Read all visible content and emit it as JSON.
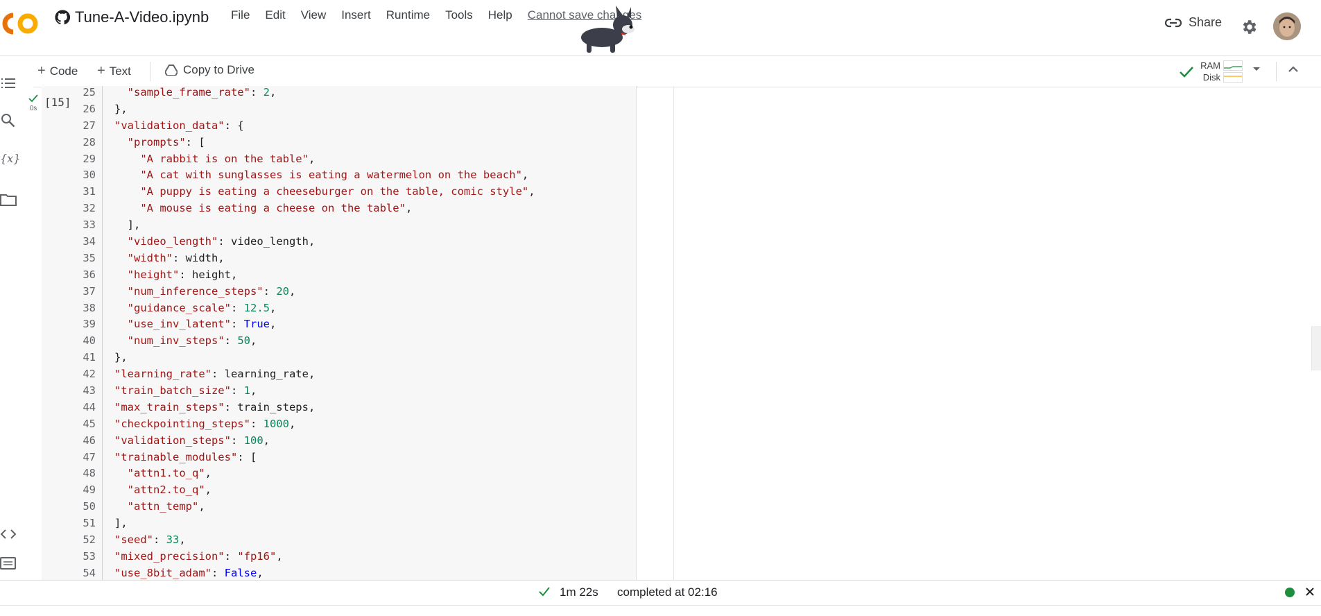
{
  "header": {
    "notebook_title": "Tune-A-Video.ipynb",
    "menu": [
      "File",
      "Edit",
      "View",
      "Insert",
      "Runtime",
      "Tools",
      "Help"
    ],
    "cannot_save": "Cannot save changes",
    "share_label": "Share"
  },
  "toolbar": {
    "code_label": "Code",
    "text_label": "Text",
    "copy_label": "Copy to Drive",
    "ram_label": "RAM",
    "disk_label": "Disk"
  },
  "cell": {
    "status_time": "0s",
    "exec_count": "[15]"
  },
  "code_lines": [
    {
      "n": "25",
      "html": "  <span class='s'>\"sample_frame_rate\"</span>: <span class='n'>2</span>,"
    },
    {
      "n": "26",
      "html": "},"
    },
    {
      "n": "27",
      "html": "<span class='s'>\"validation_data\"</span>: {"
    },
    {
      "n": "28",
      "html": "  <span class='s'>\"prompts\"</span>: ["
    },
    {
      "n": "29",
      "html": "    <span class='s'>\"A rabbit is on the table\"</span>,"
    },
    {
      "n": "30",
      "html": "    <span class='s'>\"A cat with sunglasses is eating a watermelon on the beach\"</span>,"
    },
    {
      "n": "31",
      "html": "    <span class='s'>\"A puppy is eating a cheeseburger on the table, comic style\"</span>,"
    },
    {
      "n": "32",
      "html": "    <span class='s'>\"A mouse is eating a cheese on the table\"</span>,"
    },
    {
      "n": "33",
      "html": "  ],"
    },
    {
      "n": "34",
      "html": "  <span class='s'>\"video_length\"</span>: video_length,"
    },
    {
      "n": "35",
      "html": "  <span class='s'>\"width\"</span>: width,"
    },
    {
      "n": "36",
      "html": "  <span class='s'>\"height\"</span>: height,"
    },
    {
      "n": "37",
      "html": "  <span class='s'>\"num_inference_steps\"</span>: <span class='n'>20</span>,"
    },
    {
      "n": "38",
      "html": "  <span class='s'>\"guidance_scale\"</span>: <span class='n'>12.5</span>,"
    },
    {
      "n": "39",
      "html": "  <span class='s'>\"use_inv_latent\"</span>: <span class='k'>True</span>,"
    },
    {
      "n": "40",
      "html": "  <span class='s'>\"num_inv_steps\"</span>: <span class='n'>50</span>,"
    },
    {
      "n": "41",
      "html": "},"
    },
    {
      "n": "42",
      "html": "<span class='s'>\"learning_rate\"</span>: learning_rate,"
    },
    {
      "n": "43",
      "html": "<span class='s'>\"train_batch_size\"</span>: <span class='n'>1</span>,"
    },
    {
      "n": "44",
      "html": "<span class='s'>\"max_train_steps\"</span>: train_steps,"
    },
    {
      "n": "45",
      "html": "<span class='s'>\"checkpointing_steps\"</span>: <span class='n'>1000</span>,"
    },
    {
      "n": "46",
      "html": "<span class='s'>\"validation_steps\"</span>: <span class='n'>100</span>,"
    },
    {
      "n": "47",
      "html": "<span class='s'>\"trainable_modules\"</span>: ["
    },
    {
      "n": "48",
      "html": "  <span class='s'>\"attn1.to_q\"</span>,"
    },
    {
      "n": "49",
      "html": "  <span class='s'>\"attn2.to_q\"</span>,"
    },
    {
      "n": "50",
      "html": "  <span class='s'>\"attn_temp\"</span>,"
    },
    {
      "n": "51",
      "html": "],"
    },
    {
      "n": "52",
      "html": "<span class='s'>\"seed\"</span>: <span class='n'>33</span>,"
    },
    {
      "n": "53",
      "html": "<span class='s'>\"mixed_precision\"</span>: <span class='s'>\"fp16\"</span>,"
    },
    {
      "n": "54",
      "html": "<span class='s'>\"use_8bit_adam\"</span>: <span class='k'>False</span>,"
    }
  ],
  "status": {
    "duration": "1m 22s",
    "completed": "completed at 02:16"
  },
  "colors": {
    "string": "#a31515",
    "number": "#098658",
    "keyword": "#0000ff",
    "success": "#1e8e3e",
    "logo_orange": "#f9ab00",
    "logo_dark_orange": "#e8710a"
  }
}
